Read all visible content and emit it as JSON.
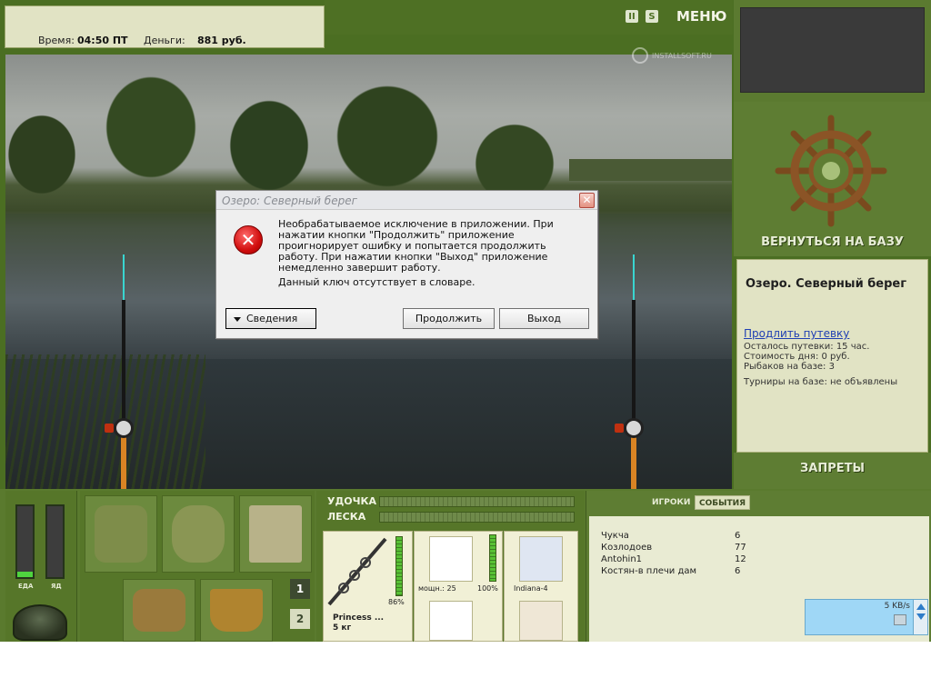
{
  "status": {
    "time_label": "Время:",
    "time_value": "04:50 ПТ",
    "money_label": "Деньги:",
    "money_value": "881 руб."
  },
  "top": {
    "menu_label": "МЕНЮ",
    "pause_icon": "pause-icon",
    "sound_icon": "sound-icon",
    "watermark": "INSTALLSOFT.RU"
  },
  "dialog": {
    "title": "Озеро: Северный берег",
    "message": "Необрабатываемое исключение в приложении. При нажатии кнопки \"Продолжить\" приложение проигнорирует ошибку и попытается продолжить работу. При нажатии кнопки \"Выход\" приложение немедленно завершит работу.",
    "detail": "Данный ключ отсутствует в словаре.",
    "details_button": "Сведения",
    "continue_button": "Продолжить",
    "exit_button": "Выход",
    "close_glyph": "✕",
    "error_glyph": "✕"
  },
  "right_panel": {
    "back_to_base": "ВЕРНУТЬСЯ НА БАЗУ",
    "location": "Озеро. Северный берег",
    "extend_link": "Продлить путевку",
    "remaining": "Осталось путевки: 15 час.",
    "day_cost": "Стоимость дня: 0 руб.",
    "fishers": "Рыбаков на базе: 3",
    "tournaments": "Турниры на базе: не объявлены",
    "bans": "ЗАПРЕТЫ"
  },
  "meters": {
    "food_label": "ЕДА",
    "poison_label": "ЯД",
    "food_level": 0.08,
    "poison_level": 0.0
  },
  "inventory": {
    "page1": "1",
    "page2": "2"
  },
  "tackle": {
    "rod_label": "УДОЧКА",
    "line_label": "ЛЕСКА",
    "rod_percent": "86%",
    "rod_name": "Princess ...",
    "rod_weight": "5 кг",
    "reel_power": "мощн.: 25",
    "reel_percent": "100%",
    "line_name": "Indiana-4"
  },
  "events": {
    "tab_players": "ИГРОКИ",
    "tab_events": "СОБЫТИЯ",
    "players": [
      {
        "name": "Чукча",
        "score": "6"
      },
      {
        "name": "Козлодоев",
        "score": "77"
      },
      {
        "name": "Antohin1",
        "score": "12"
      },
      {
        "name": "Костян-в плечи дам",
        "score": "6"
      }
    ],
    "net_speed": "5 KB/s"
  },
  "colors": {
    "panel_green": "#4b6e22",
    "parchment": "#e1e3c4",
    "meter_green": "#4fd43f",
    "link_blue": "#1f3fb3"
  }
}
